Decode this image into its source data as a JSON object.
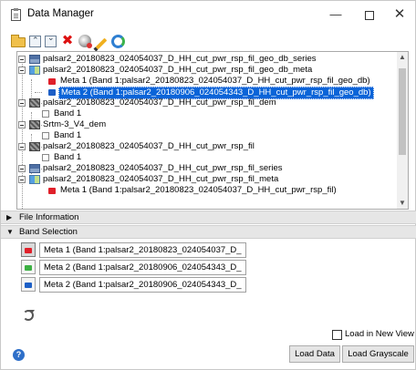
{
  "window": {
    "title": "Data Manager",
    "minimize": "—",
    "close": "✕"
  },
  "toolbar": {
    "icons": [
      "open-icon",
      "collapse-all-icon",
      "expand-all-icon",
      "delete-icon",
      "remove-icon",
      "edit-icon",
      "refresh-icon"
    ]
  },
  "tree": {
    "rows": [
      {
        "label": "palsar2_20180823_024054037_D_HH_cut_pwr_rsp_fil_geo_db_series",
        "icon": "series-icon"
      },
      {
        "label": "palsar2_20180823_024054037_D_HH_cut_pwr_rsp_fil_geo_db_meta",
        "icon": "meta-icon"
      },
      {
        "label": "Meta 1 (Band 1:palsar2_20180823_024054037_D_HH_cut_pwr_rsp_fil_geo_db)",
        "icon": "red-band-icon"
      },
      {
        "label": "Meta 2 (Band 1:palsar2_20180906_024054343_D_HH_cut_pwr_rsp_fil_geo_db)",
        "icon": "blue-band-icon",
        "selected": true
      },
      {
        "label": "palsar2_20180823_024054037_D_HH_cut_pwr_rsp_fil_dem",
        "icon": "raster-icon"
      },
      {
        "label": "Band 1",
        "icon": "band-icon"
      },
      {
        "label": "Srtm-3_V4_dem",
        "icon": "raster-icon"
      },
      {
        "label": "Band 1",
        "icon": "band-icon"
      },
      {
        "label": "palsar2_20180823_024054037_D_HH_cut_pwr_rsp_fil",
        "icon": "raster-icon"
      },
      {
        "label": "Band 1",
        "icon": "band-icon"
      },
      {
        "label": "palsar2_20180823_024054037_D_HH_cut_pwr_rsp_fil_series",
        "icon": "series-icon"
      },
      {
        "label": "palsar2_20180823_024054037_D_HH_cut_pwr_rsp_fil_meta",
        "icon": "meta-icon"
      },
      {
        "label": "Meta 1 (Band 1:palsar2_20180823_024054037_D_HH_cut_pwr_rsp_fil)",
        "icon": "red-band-icon"
      }
    ]
  },
  "sections": {
    "file_info": "File Information",
    "band_selection": "Band Selection"
  },
  "bands": [
    {
      "value": "Meta 1 (Band 1:palsar2_20180823_024054037_D_",
      "color": "#e0202a"
    },
    {
      "value": "Meta 2 (Band 1:palsar2_20180906_024054343_D_",
      "color": "#3cb043"
    },
    {
      "value": "Meta 2 (Band 1:palsar2_20180906_024054343_D_",
      "color": "#1d5fc6"
    }
  ],
  "options": {
    "load_new_view": "Load in New View",
    "load_new_view_checked": false
  },
  "buttons": {
    "load_data": "Load Data",
    "load_grayscale": "Load Grayscale"
  },
  "colors": {
    "selection": "#0a64d8",
    "section_bar": "#e6e6e6"
  }
}
